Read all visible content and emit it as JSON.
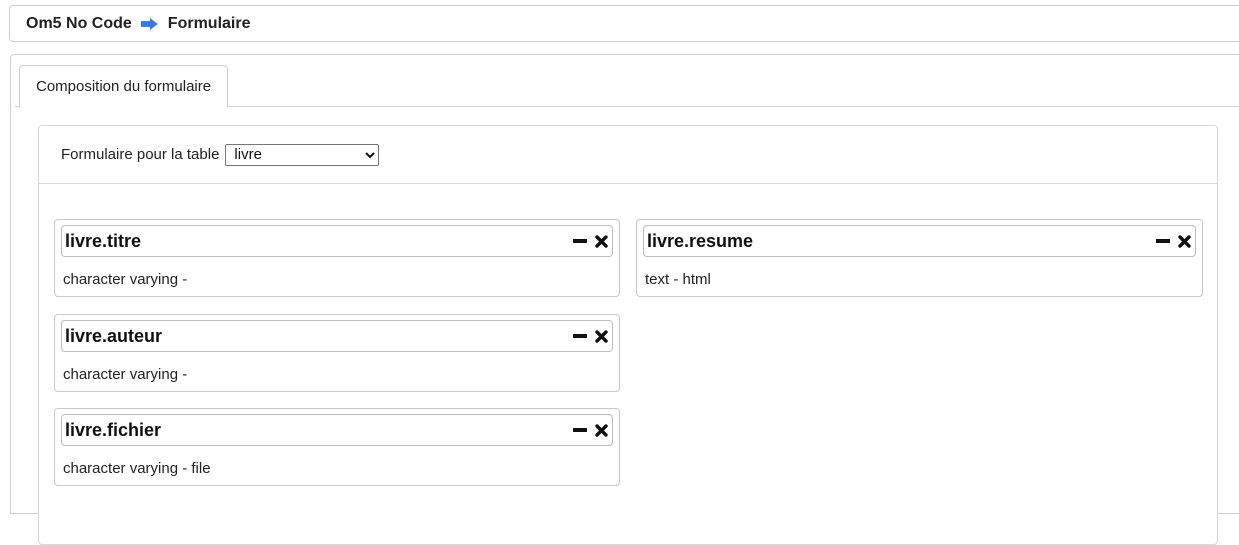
{
  "breadcrumb": {
    "app": "Om5 No Code",
    "page": "Formulaire"
  },
  "tabs": [
    {
      "label": "Composition du formulaire"
    }
  ],
  "form": {
    "table_label": "Formulaire pour la table",
    "table_select_value": "livre"
  },
  "fields": [
    {
      "name": "livre.titre",
      "type": "character varying -"
    },
    {
      "name": "livre.auteur",
      "type": "character varying -"
    },
    {
      "name": "livre.fichier",
      "type": "character varying - file"
    },
    {
      "name": "livre.resume",
      "type": "text - html"
    }
  ],
  "icons": {
    "breadcrumb_separator": "arrow-right-icon",
    "collapse": "minus-icon",
    "remove": "close-icon"
  },
  "colors": {
    "arrow": "#3b7ddd"
  }
}
